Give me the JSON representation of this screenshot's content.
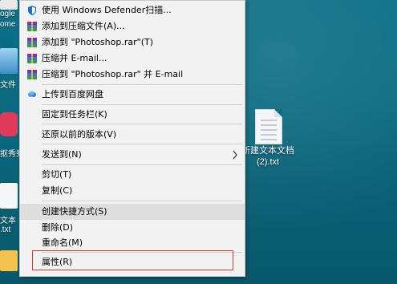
{
  "desktop": {
    "file": {
      "name": "新建文本文档\n(2).txt"
    },
    "edge_labels": [
      "ogle",
      "ome",
      "文件",
      "抠秀秀",
      "文本",
      ".txt"
    ]
  },
  "context_menu": {
    "items": [
      {
        "label": "使用 Windows Defender扫描...",
        "icon": "defender-shield-icon"
      },
      {
        "label": "添加到压缩文件(A)...",
        "icon": "winrar-archive-icon"
      },
      {
        "label": "添加到 \"Photoshop.rar\"(T)",
        "icon": "winrar-archive-icon"
      },
      {
        "label": "压缩并 E-mail...",
        "icon": "winrar-archive-icon"
      },
      {
        "label": "压缩到 \"Photoshop.rar\" 并 E-mail",
        "icon": "winrar-archive-icon"
      },
      {
        "label": "上传到百度网盘",
        "icon": "baidu-cloud-icon"
      },
      {
        "label": "固定到任务栏(K)",
        "icon": ""
      },
      {
        "label": "还原以前的版本(V)",
        "icon": ""
      },
      {
        "label": "发送到(N)",
        "icon": ""
      },
      {
        "label": "剪切(T)",
        "icon": ""
      },
      {
        "label": "复制(C)",
        "icon": ""
      },
      {
        "label": "创建快捷方式(S)",
        "icon": ""
      },
      {
        "label": "删除(D)",
        "icon": ""
      },
      {
        "label": "重命名(M)",
        "icon": ""
      },
      {
        "label": "属性(R)",
        "icon": ""
      }
    ],
    "highlighted_item": "创建快捷方式(S)",
    "outlined_item": "属性(R)"
  },
  "colors": {
    "desktop_bg": "#0a6b81",
    "menu_bg": "#f2f2f2",
    "highlight_bg": "#dedede",
    "outline_red": "#e0322f"
  }
}
